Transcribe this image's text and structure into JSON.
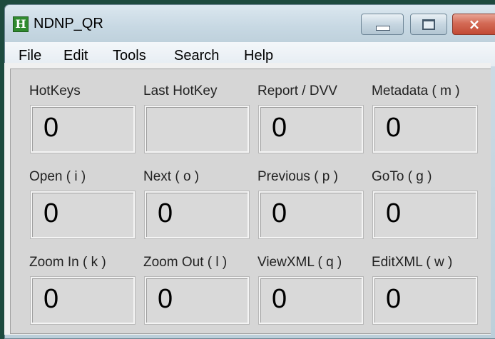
{
  "window": {
    "title": "NDNP_QR",
    "app_icon": "H",
    "controls": {
      "minimize": "minimize-icon",
      "maximize": "maximize-icon",
      "close": "close-icon",
      "close_glyph": "×"
    }
  },
  "menu": {
    "items": [
      "File",
      "Edit",
      "Tools",
      "Search",
      "Help"
    ]
  },
  "counters": [
    {
      "label": "HotKeys",
      "value": "0"
    },
    {
      "label": "Last HotKey",
      "value": ""
    },
    {
      "label": "Report / DVV",
      "value": "0"
    },
    {
      "label": "Metadata ( m )",
      "value": "0"
    },
    {
      "label": "Open ( i )",
      "value": "0"
    },
    {
      "label": "Next ( o )",
      "value": "0"
    },
    {
      "label": "Previous ( p )",
      "value": "0"
    },
    {
      "label": "GoTo ( g )",
      "value": "0"
    },
    {
      "label": "Zoom In ( k )",
      "value": "0"
    },
    {
      "label": "Zoom Out ( l )",
      "value": "0"
    },
    {
      "label": "ViewXML ( q )",
      "value": "0"
    },
    {
      "label": "EditXML ( w )",
      "value": "0"
    }
  ],
  "colors": {
    "desktop": "#1d4a3e",
    "title_bar": "#c7d8e3",
    "close_button": "#c24a35",
    "panel": "#d6d6d6"
  }
}
